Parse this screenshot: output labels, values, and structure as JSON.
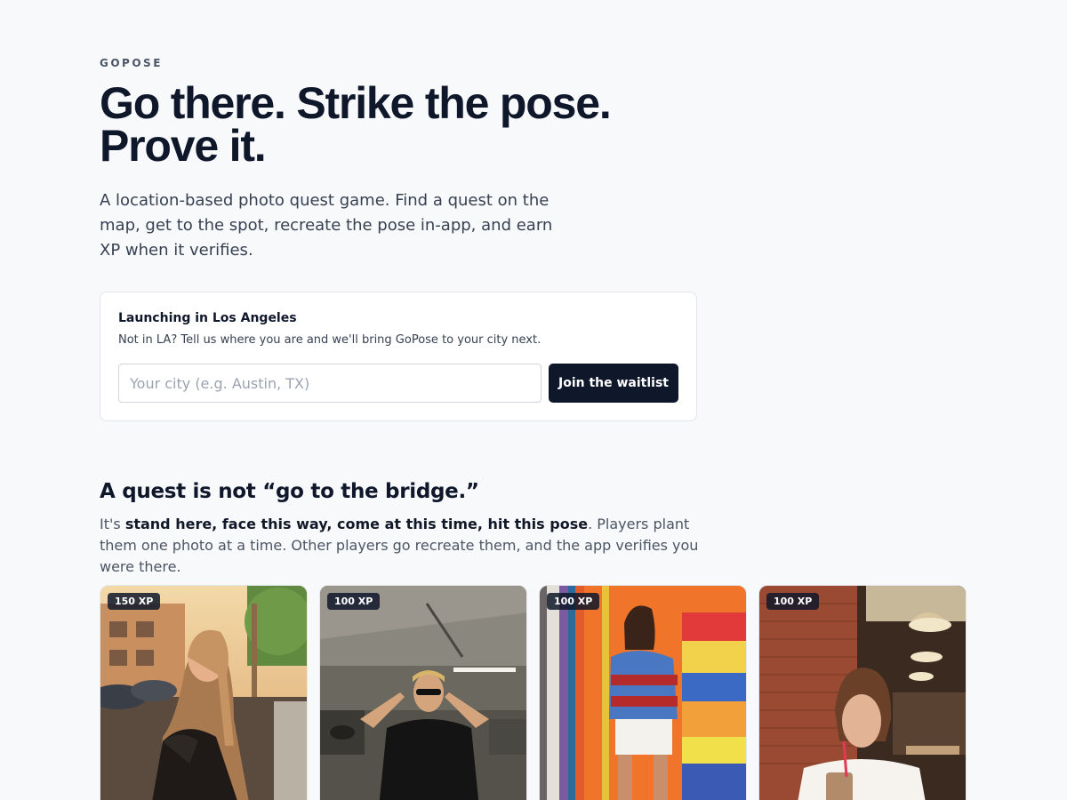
{
  "brand": "GOPOSE",
  "hero": {
    "headline_line1": "Go there. Strike the pose.",
    "headline_line2": "Prove it.",
    "lede": "A location-based photo quest game. Find a quest on the map, get to the spot, recreate the pose in-app, and earn XP when it verifies."
  },
  "waitlist": {
    "title": "Launching in Los Angeles",
    "subtitle": "Not in LA? Tell us where you are and we'll bring GoPose to your city next.",
    "input_value": "",
    "input_placeholder": "Your city (e.g. Austin, TX)",
    "button_label": "Join the waitlist"
  },
  "explainer": {
    "title": "A quest is not “go to the bridge.”",
    "prefix": "It's ",
    "emphasis": "stand here, face this way, come at this time, hit this pose",
    "suffix": ". Players plant them one photo at a time. Other players go recreate them, and the app verifies you were there."
  },
  "quests": [
    {
      "xp": "150 XP",
      "scene": "sunset-street-portrait"
    },
    {
      "xp": "100 XP",
      "scene": "parking-garage-sunglasses"
    },
    {
      "xp": "100 XP",
      "scene": "painted-wall-phone-call"
    },
    {
      "xp": "100 XP",
      "scene": "brick-cafe-iced-drink"
    }
  ],
  "colors": {
    "page_bg": "#f8f9fb",
    "ink": "#0f172a",
    "muted": "#4b5563",
    "button_bg": "#0f172a",
    "card_border": "#e2e5ea"
  }
}
